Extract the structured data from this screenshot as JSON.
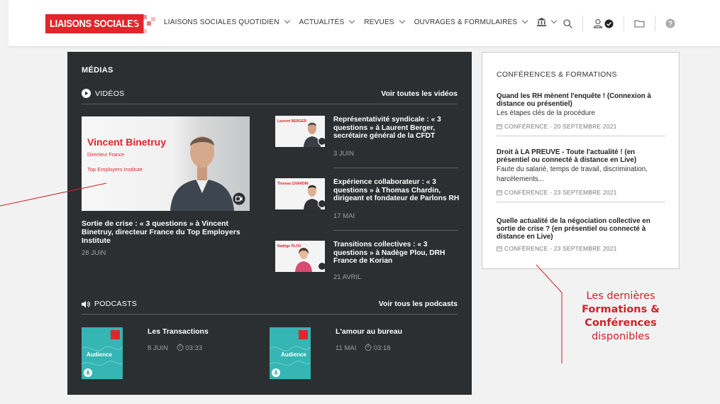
{
  "header": {
    "logo_text": "LIAISONS SOCIALES",
    "nav": [
      {
        "label": "LIAISONS SOCIALES QUOTIDIEN"
      },
      {
        "label": "ACTUALITÉS"
      },
      {
        "label": "REVUES"
      },
      {
        "label": "OUVRAGES & FORMULAIRES"
      }
    ],
    "icons": [
      "bank-icon",
      "search-icon",
      "user-icon",
      "folder-icon",
      "help-icon"
    ]
  },
  "media": {
    "title": "MÉDIAS",
    "videos_label": "VIDÉOS",
    "see_all_videos": "Voir toutes les vidéos",
    "main_video": {
      "thumb_name": "Vincent Binetruy",
      "thumb_role": "Directeur France",
      "thumb_org": "Top Employers Institute",
      "caption": "Sortie de crise : « 3 questions » à Vincent Binetruy, directeur France du Top Employers Institute",
      "date": "28 JUIN"
    },
    "videos": [
      {
        "thumb_name": "Laurent BERGER",
        "title": "Représentativité syndicale : « 3 questions » à Laurent Berger, secrétaire général de la CFDT",
        "date": "3 JUIN"
      },
      {
        "thumb_name": "Thomas CHARDIN",
        "title": "Expérience collaborateur : « 3 questions » à Thomas Chardin, dirigeant et fondateur de Parlons RH",
        "date": "17 MAI"
      },
      {
        "thumb_name": "Nadège PLOU",
        "title": "Transitions collectives : « 3 questions » à Nadège Plou, DRH France de Korian",
        "date": "21 AVRIL"
      }
    ],
    "podcasts_label": "PODCASTS",
    "see_all_podcasts": "Voir tous les podcasts",
    "podcasts": [
      {
        "thumb_text": "Audience",
        "title": "Les Transactions",
        "date": "8 JUIN",
        "duration": "03:33"
      },
      {
        "thumb_text": "Audience",
        "title": "L'amour au bureau",
        "date": "11 MAI",
        "duration": "03:18"
      }
    ]
  },
  "conferences": {
    "title": "CONFÉRENCES & FORMATIONS",
    "items": [
      {
        "title": "Quand les RH mènent l'enquête ! (Connexion à distance ou présentiel)",
        "desc": "Les étapes clés de la procédure",
        "meta": "CONFÉRENCE - 20 SEPTEMBRE 2021"
      },
      {
        "title": "Droit à LA PREUVE - Toute l'actualité ! (en présentiel ou connecté à distance en Live)",
        "desc": "Faute du salarié, temps de travail, discrimination, harcèlements...",
        "meta": "CONFÉRENCE - 23 SEPTEMBRE 2021"
      },
      {
        "title": "Quelle actualité de la négociation collective en sortie de crise ? (en présentiel ou connecté à distance en Live)",
        "desc": "",
        "meta": "CONFÉRENCE - 23 SEPTEMBRE 2021"
      }
    ]
  },
  "annotation": {
    "line1": "Les dernières",
    "line2": "Formations &",
    "line3": "Conférences",
    "line4": "disponibles"
  },
  "colors": {
    "brand_red": "#e2242b",
    "panel_dark": "#2b2f31",
    "podcast_teal": "#35b5b4"
  }
}
